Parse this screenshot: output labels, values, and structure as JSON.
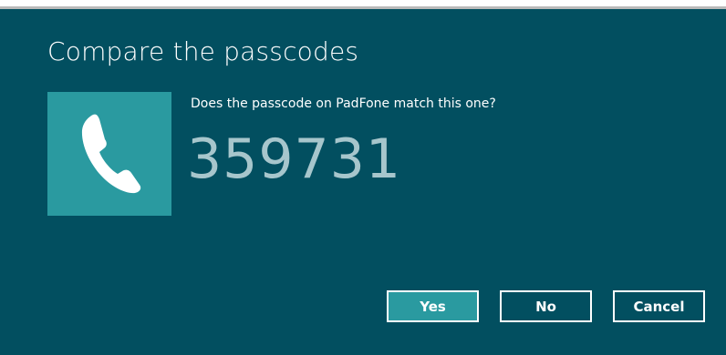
{
  "dialog": {
    "title": "Compare the passcodes",
    "question": "Does the passcode on PadFone match this one?",
    "passcode": "359731",
    "icon": "phone-icon"
  },
  "buttons": {
    "yes_label": "Yes",
    "no_label": "No",
    "cancel_label": "Cancel"
  },
  "colors": {
    "background": "#024f60",
    "tile": "#2a9aa0",
    "passcode_text": "#a7c6cc",
    "primary_button": "#2a9aa0"
  }
}
